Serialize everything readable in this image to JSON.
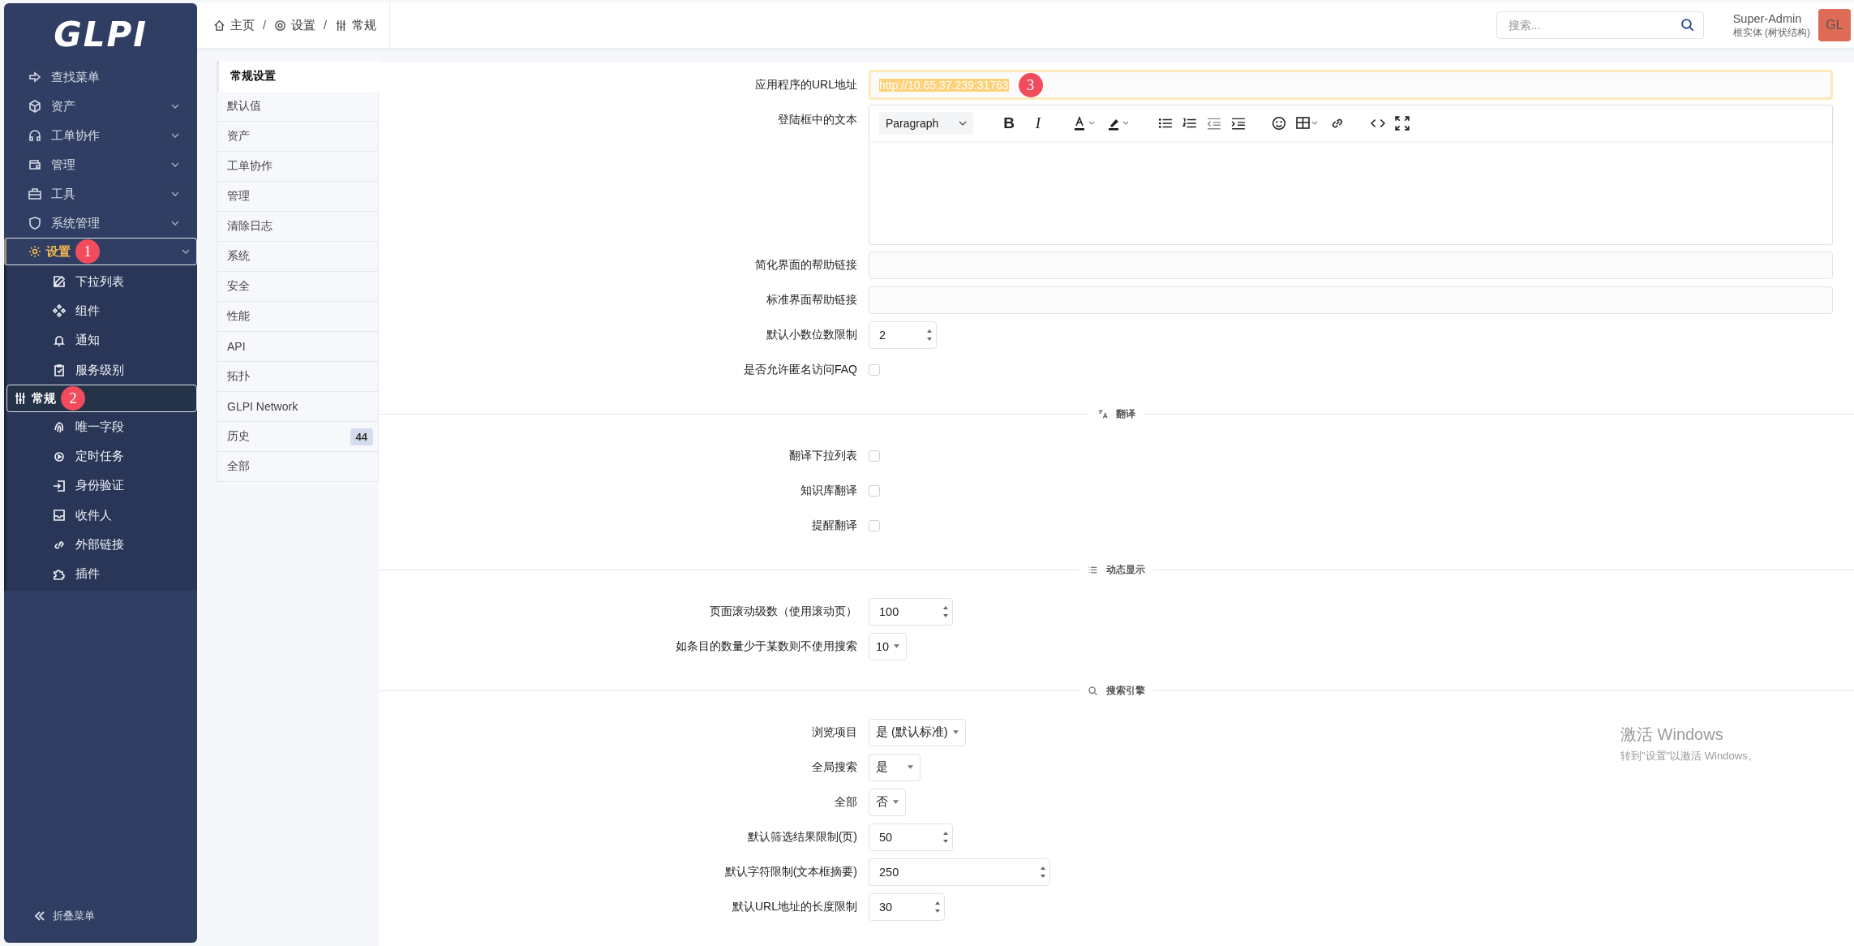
{
  "sidebar": {
    "logo": "GLPI",
    "items": [
      {
        "label": "查找菜单",
        "expandable": false,
        "selected": false
      },
      {
        "label": "资产",
        "expandable": true,
        "selected": false
      },
      {
        "label": "工单协作",
        "expandable": true,
        "selected": false
      },
      {
        "label": "管理",
        "expandable": true,
        "selected": false
      },
      {
        "label": "工具",
        "expandable": true,
        "selected": false
      },
      {
        "label": "系统管理",
        "expandable": true,
        "selected": false
      },
      {
        "label": "设置",
        "expandable": true,
        "selected": true,
        "annotation": "1",
        "children": [
          {
            "label": "下拉列表",
            "selected": false
          },
          {
            "label": "组件",
            "selected": false
          },
          {
            "label": "通知",
            "selected": false
          },
          {
            "label": "服务级别",
            "selected": false
          },
          {
            "label": "常规",
            "selected": true,
            "annotation": "2"
          },
          {
            "label": "唯一字段",
            "selected": false
          },
          {
            "label": "定时任务",
            "selected": false
          },
          {
            "label": "身份验证",
            "selected": false
          },
          {
            "label": "收件人",
            "selected": false
          },
          {
            "label": "外部链接",
            "selected": false
          },
          {
            "label": "插件",
            "selected": false
          }
        ]
      }
    ],
    "collapse": "折叠菜单"
  },
  "breadcrumb": [
    "主页",
    "设置",
    "常规"
  ],
  "breadcrumb_separator": "/",
  "search": {
    "placeholder": "搜索..."
  },
  "user": {
    "name": "Super-Admin",
    "entity": "根实体 (树状结构)",
    "initials": "GL"
  },
  "tabs": [
    {
      "label": "常规设置",
      "selected": true
    },
    {
      "label": "默认值",
      "selected": false
    },
    {
      "label": "资产",
      "selected": false
    },
    {
      "label": "工单协作",
      "selected": false
    },
    {
      "label": "管理",
      "selected": false
    },
    {
      "label": "清除日志",
      "selected": false
    },
    {
      "label": "系统",
      "selected": false
    },
    {
      "label": "安全",
      "selected": false
    },
    {
      "label": "性能",
      "selected": false
    },
    {
      "label": "API",
      "selected": false
    },
    {
      "label": "拓扑",
      "selected": false
    },
    {
      "label": "GLPI Network",
      "selected": false
    },
    {
      "label": "历史",
      "selected": false,
      "count": "44"
    },
    {
      "label": "全部",
      "selected": false
    }
  ],
  "sections": [
    {
      "rows": [
        {
          "kind": "text",
          "label": "应用程序的URL地址",
          "value": "http://10.65.37.239:31763",
          "highlighted": true,
          "annotation": "3"
        },
        {
          "kind": "editor",
          "label": "登陆框中的文本",
          "format": "Paragraph",
          "bold": "B",
          "italic": "I"
        },
        {
          "kind": "text",
          "label": "简化界面的帮助链接",
          "value": ""
        },
        {
          "kind": "text",
          "label": "标准界面帮助链接",
          "value": ""
        },
        {
          "kind": "number",
          "label": "默认小数位数限制",
          "value": "2"
        },
        {
          "kind": "checkbox",
          "label": "是否允许匿名访问FAQ",
          "checked": false
        }
      ]
    },
    {
      "heading": "翻译",
      "rows": [
        {
          "kind": "checkbox",
          "label": "翻译下拉列表",
          "checked": false
        },
        {
          "kind": "checkbox",
          "label": "知识库翻译",
          "checked": false
        },
        {
          "kind": "checkbox",
          "label": "提醒翻译",
          "checked": false
        }
      ]
    },
    {
      "heading": "动态显示",
      "rows": [
        {
          "kind": "number",
          "label": "页面滚动级数（使用滚动页）",
          "value": "100"
        },
        {
          "kind": "select",
          "label": "如条目的数量少于某数则不使用搜索",
          "value": "10"
        }
      ]
    },
    {
      "heading": "搜索引擎",
      "rows": [
        {
          "kind": "select",
          "label": "浏览项目",
          "value": "是 (默认标准)"
        },
        {
          "kind": "select",
          "label": "全局搜索",
          "value": "是"
        },
        {
          "kind": "select",
          "label": "全部",
          "value": "否"
        },
        {
          "kind": "number",
          "label": "默认筛选结果限制(页)",
          "value": "50"
        },
        {
          "kind": "number",
          "label": "默认字符限制(文本框摘要)",
          "value": "250"
        },
        {
          "kind": "number",
          "label": "默认URL地址的长度限制",
          "value": "30"
        }
      ]
    }
  ],
  "os_notice": {
    "title": "激活 Windows",
    "text": "转到\"设置\"以激活 Windows。"
  }
}
